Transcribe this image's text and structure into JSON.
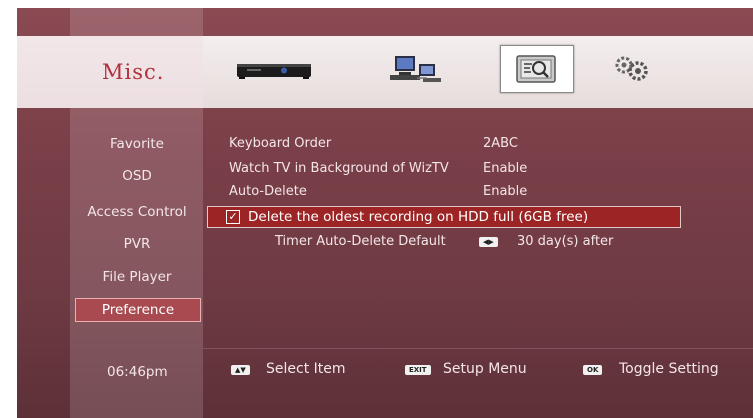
{
  "header": {
    "title": "Misc.",
    "icons": [
      "settopbox-icon",
      "network-computers-icon",
      "settings-panel-icon",
      "gears-icon"
    ]
  },
  "sidebar": {
    "items": [
      {
        "label": "Favorite"
      },
      {
        "label": "OSD"
      },
      {
        "label": "Access Control"
      },
      {
        "label": "PVR"
      },
      {
        "label": "File Player"
      },
      {
        "label": "Preference"
      }
    ],
    "active_item": "Preference",
    "clock": "06:46pm"
  },
  "settings": {
    "keyboard_order": {
      "label": "Keyboard Order",
      "value": "2ABC"
    },
    "watch_tv": {
      "label": "Watch TV in Background of WizTV",
      "value": "Enable"
    },
    "auto_delete": {
      "label": "Auto-Delete",
      "value": "Enable"
    },
    "delete_oldest": {
      "label": "Delete the oldest recording on HDD full (6GB free)",
      "checked": true
    },
    "timer_auto_delete": {
      "label": "Timer Auto-Delete Default",
      "value": "30 day(s) after"
    }
  },
  "footer": {
    "select": {
      "key": "▲▼",
      "label": "Select Item"
    },
    "setup": {
      "key": "EXIT",
      "label": "Setup Menu"
    },
    "toggle": {
      "key": "OK",
      "label": "Toggle Setting"
    }
  },
  "colors": {
    "background": "#7a3f48",
    "highlight": "#9d2424",
    "title": "#b0303b",
    "topband": "#efe6e6"
  }
}
